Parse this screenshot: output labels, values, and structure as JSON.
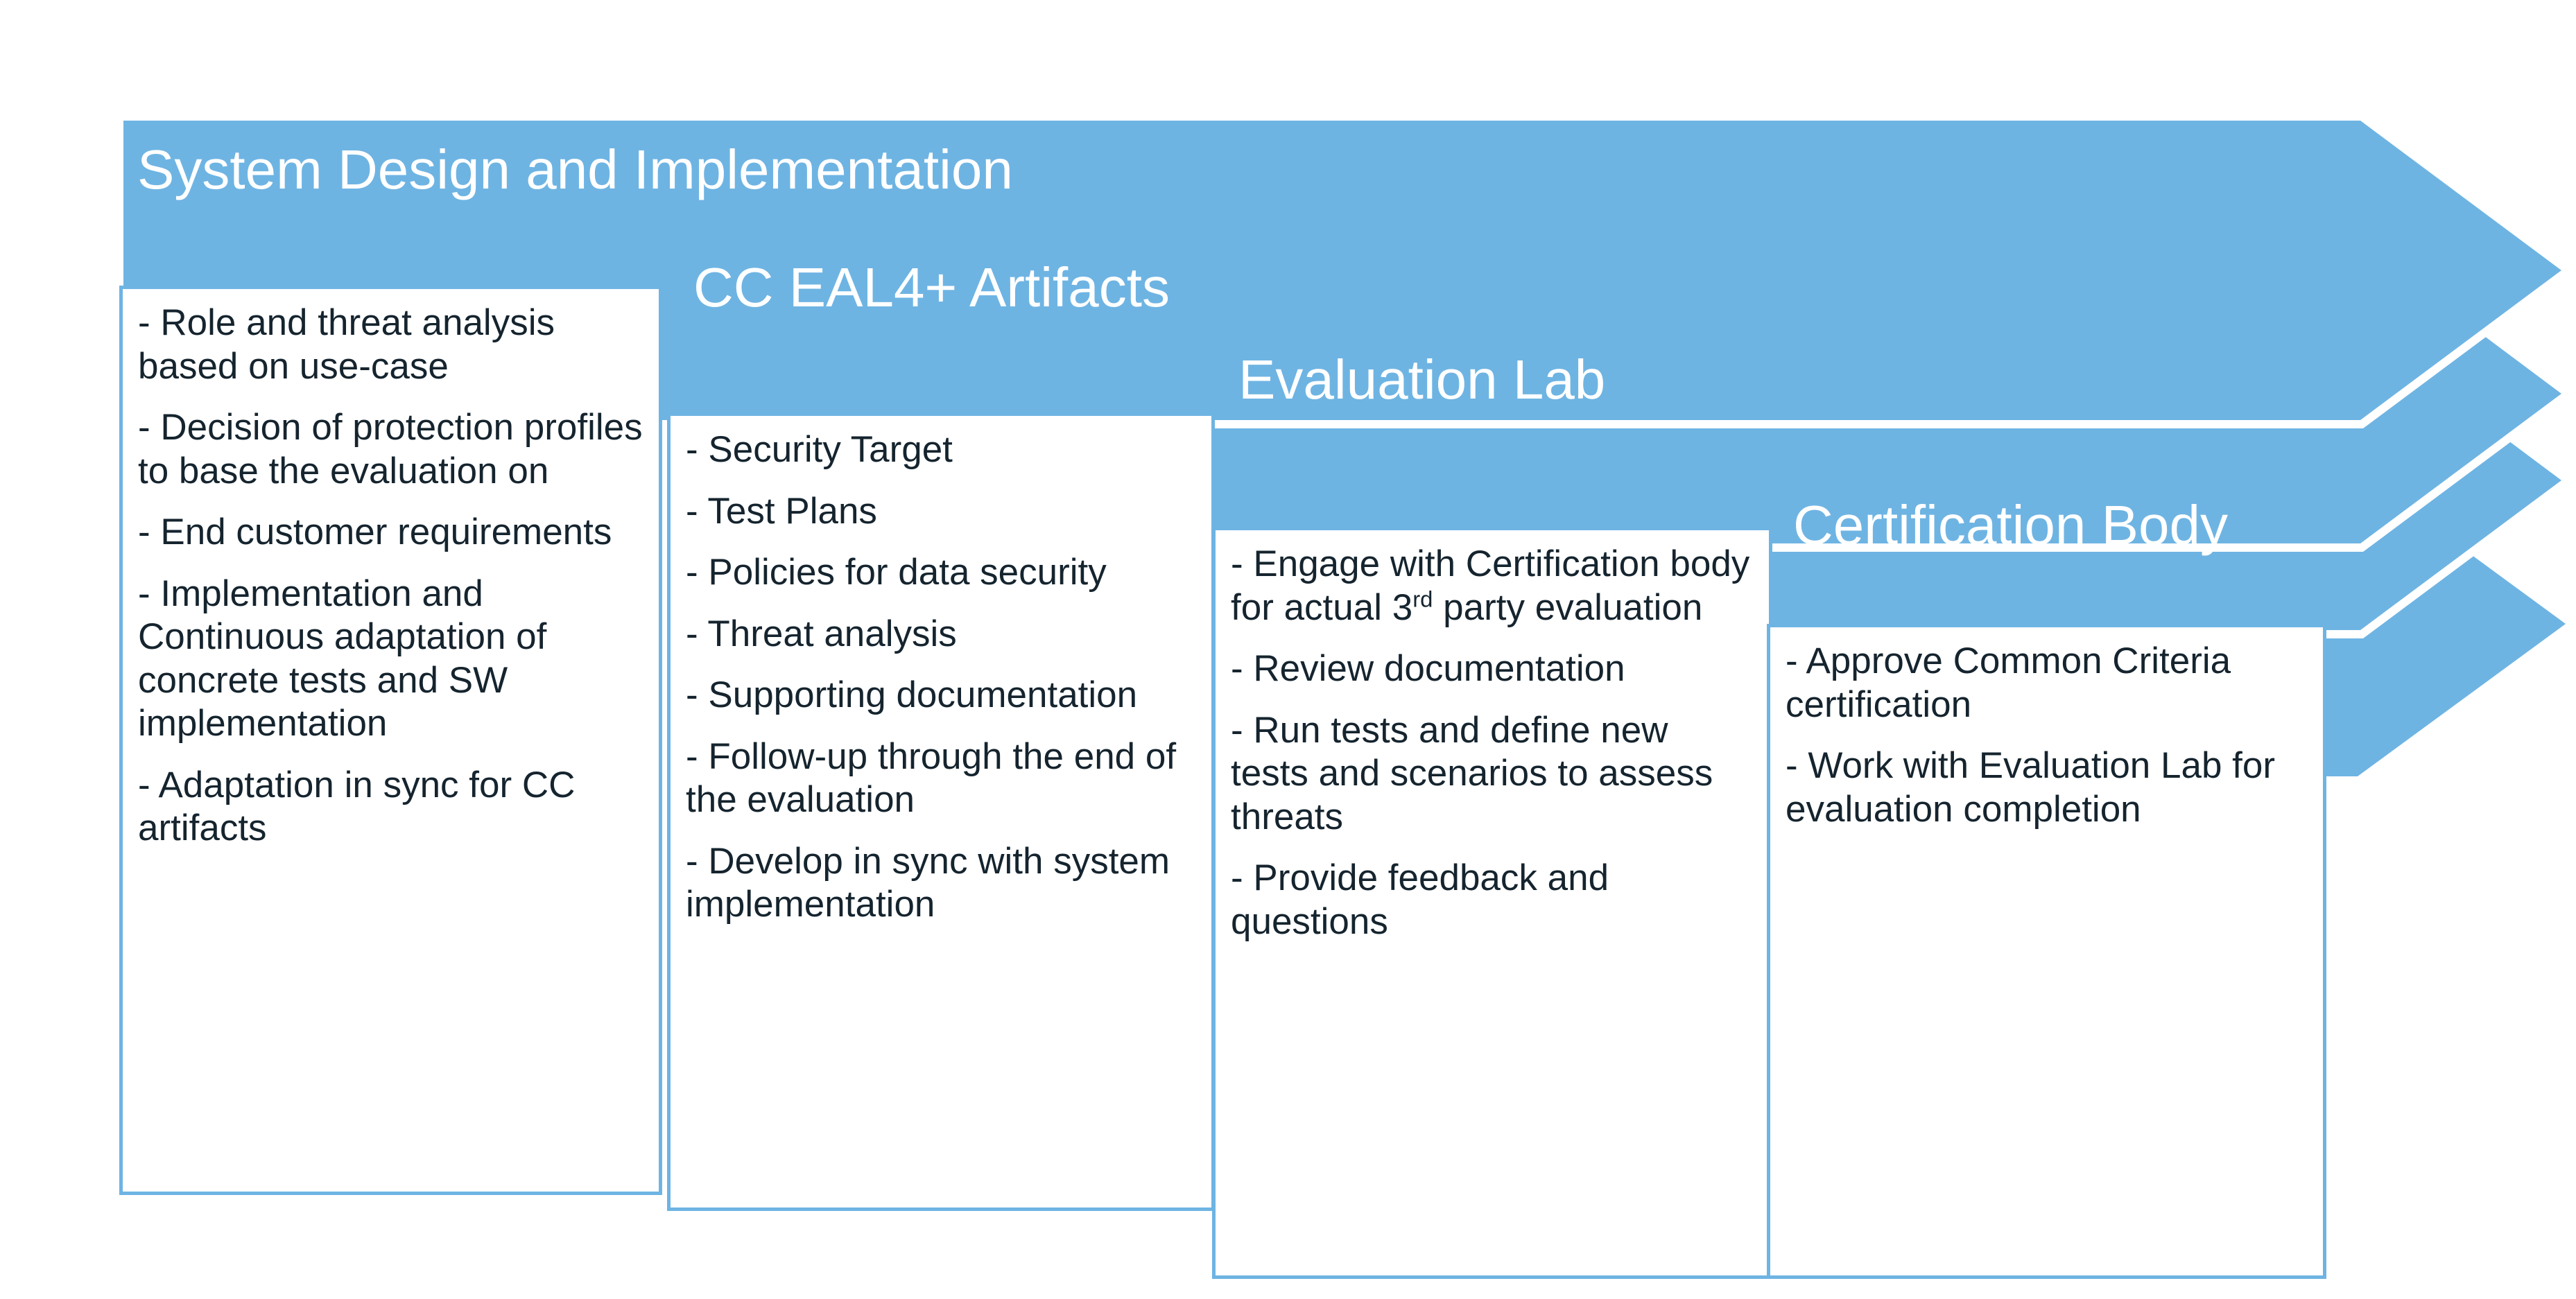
{
  "diagram": {
    "type": "chevron-process",
    "accent_color": "#6EB4E3",
    "text_color": "#15242E",
    "title_color": "#FFFFFF",
    "stages": [
      {
        "id": "system-design-and-implementation",
        "title": "System Design and Implementation",
        "bullets": [
          "-   Role and threat analysis based on use-case",
          "- Decision of protection profiles to base the evaluation on",
          "- End customer requirements",
          "- Implementation and Continuous adaptation of concrete tests and SW implementation",
          "- Adaptation in sync for CC artifacts"
        ]
      },
      {
        "id": "cc-eal4-plus-artifacts",
        "title": "CC EAL4+ Artifacts",
        "bullets": [
          "- Security Target",
          "- Test Plans",
          "- Policies for data security",
          "- Threat analysis",
          "- Supporting documentation",
          "- Follow-up through the end of the evaluation",
          "- Develop in sync with system implementation"
        ]
      },
      {
        "id": "evaluation-lab",
        "title": "Evaluation Lab",
        "bullets": [
          "- Engage with Certification body for actual 3<sup>rd</sup> party evaluation",
          "- Review documentation",
          "- Run tests and define new tests and scenarios to assess threats",
          "- Provide feedback and questions"
        ]
      },
      {
        "id": "certification-body",
        "title": "Certification Body",
        "bullets": [
          "- Approve Common Criteria certification",
          "- Work with Evaluation Lab for evaluation completion"
        ]
      }
    ]
  }
}
